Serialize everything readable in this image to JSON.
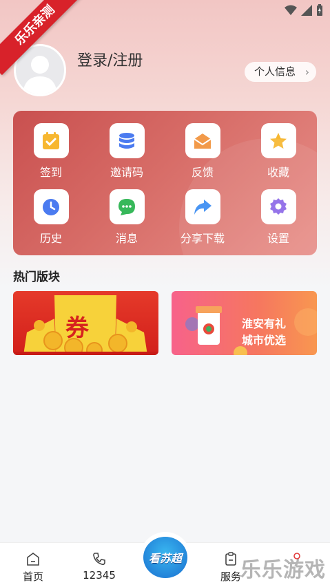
{
  "corner_ribbon": "乐乐亲测",
  "profile": {
    "login_text": "登录/注册",
    "info_button": "个人信息"
  },
  "menu": [
    {
      "label": "签到",
      "icon": "calendar-check-icon",
      "color": "#f7b730"
    },
    {
      "label": "邀请码",
      "icon": "database-icon",
      "color": "#4b7bf0"
    },
    {
      "label": "反馈",
      "icon": "envelope-icon",
      "color": "#f29a4a"
    },
    {
      "label": "收藏",
      "icon": "star-icon",
      "color": "#f7b730"
    },
    {
      "label": "历史",
      "icon": "clock-icon",
      "color": "#4b7bf0"
    },
    {
      "label": "消息",
      "icon": "chat-icon",
      "color": "#37b85a"
    },
    {
      "label": "分享下载",
      "icon": "share-arrow-icon",
      "color": "#3a8cf2"
    },
    {
      "label": "设置",
      "icon": "gear-icon",
      "color": "#8c69e8"
    }
  ],
  "section": {
    "title": "热门版块"
  },
  "banners": {
    "left": {
      "text": "券"
    },
    "right": {
      "line1": "淮安有礼",
      "line2": "城市优选"
    }
  },
  "tabbar": {
    "home": "首页",
    "hotline": "12345",
    "center": "看苏超",
    "service": "服务"
  },
  "watermark": "乐乐游戏",
  "colors": {
    "accent_red": "#d8222a",
    "card_gradient_start": "#c9504f",
    "card_gradient_end": "#e8908a"
  }
}
